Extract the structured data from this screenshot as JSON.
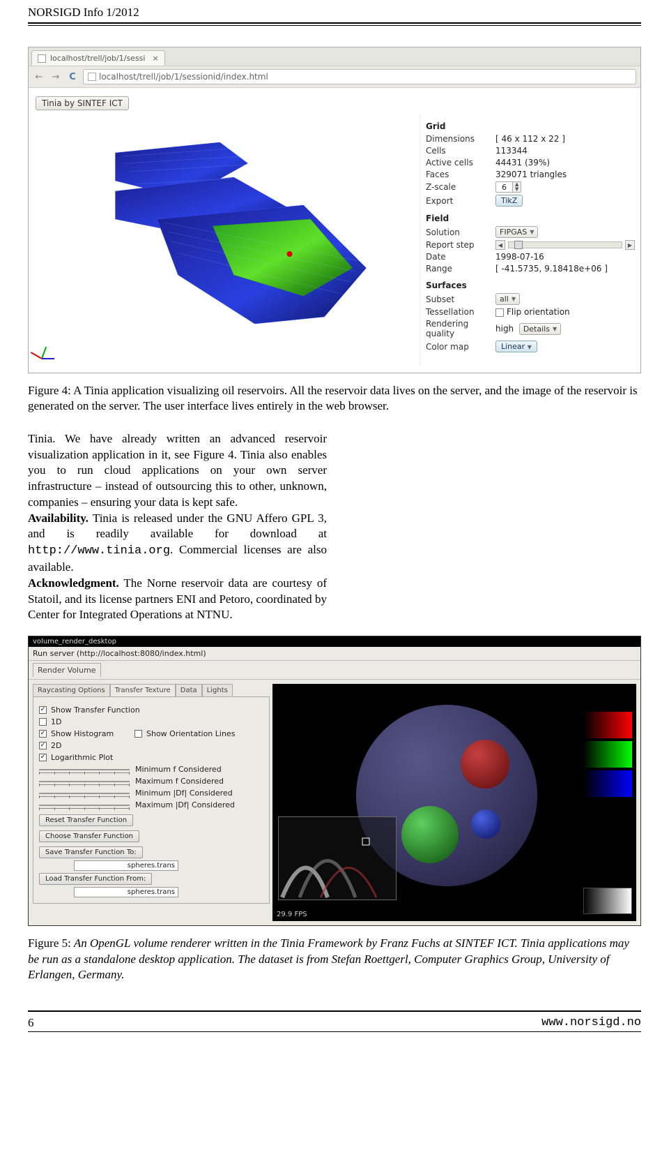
{
  "header": {
    "left": "NORSIGD Info 1/2012",
    "right": ""
  },
  "browser": {
    "tab_title": "localhost/trell/job/1/sessi",
    "url": "localhost/trell/job/1/sessionid/index.html",
    "app_button": "Tinia by SINTEF ICT"
  },
  "grid": {
    "section": "Grid",
    "dimensions_label": "Dimensions",
    "dimensions": "[ 46 x 112 x 22 ]",
    "cells_label": "Cells",
    "cells": "113344",
    "active_label": "Active cells",
    "active": "44431 (39%)",
    "faces_label": "Faces",
    "faces": "329071 triangles",
    "zscale_label": "Z-scale",
    "zscale": "6",
    "export_label": "Export",
    "export_btn": "TikZ"
  },
  "field": {
    "section": "Field",
    "solution_label": "Solution",
    "solution": "FIPGAS",
    "report_label": "Report step",
    "date_label": "Date",
    "date": "1998-07-16",
    "range_label": "Range",
    "range": "[ -41.5735, 9.18418e+06 ]"
  },
  "surfaces": {
    "section": "Surfaces",
    "subset_label": "Subset",
    "subset": "all",
    "tess_label": "Tessellation",
    "tess_chk": "Flip orientation",
    "rq_label": "Rendering quality",
    "rq_val": "high",
    "rq_btn": "Details",
    "cmap_label": "Color map",
    "cmap_btn": "Linear"
  },
  "fig4_caption_lead": "Figure 4:",
  "fig4_caption": "A Tinia application visualizing oil reservoirs. All the reservoir data lives on the server, and the image of the reservoir is generated on the server. The user interface lives entirely in the web browser.",
  "body_para": "Tinia. We have already written an advanced reservoir visualization application in it, see Figure 4. Tinia also enables you to run cloud applications on your own server infrastructure – instead of outsourcing this to other, unknown, companies – ensuring your data is kept safe.",
  "body_avail_lead": "Availability.",
  "body_avail": " Tinia is released under the GNU Affero GPL 3, and is readily available for download at ",
  "body_url": "http://www.tinia.org",
  "body_avail_tail": ". Commercial licenses are also available.",
  "body_ack_lead": "Acknowledgment.",
  "body_ack": " The Norne reservoir data are courtesy of Statoil, and its license partners ENI and Petoro, coordinated by Center for Integrated Operations at NTNU.",
  "darkapp": {
    "title": "volume_render_desktop",
    "run_server": "Run server (http://localhost:8080/index.html)",
    "tab_render": "Render Volume",
    "tabs": {
      "rc": "Raycasting Options",
      "tt": "Transfer Texture",
      "data": "Data",
      "lights": "Lights"
    },
    "chk_show_tf": "Show Transfer Function",
    "chk_1d": "1D",
    "chk_show_hist": "Show Histogram",
    "chk_orient": "Show Orientation Lines",
    "chk_2d": "2D",
    "chk_log": "Logarithmic Plot",
    "sl_min_f": "Minimum f Considered",
    "sl_max_f": "Maximum f Considered",
    "sl_min_df": "Minimum |Df| Considered",
    "sl_max_df": "Maximum |Df| Considered",
    "btn_reset": "Reset Transfer Function",
    "btn_choose": "Choose Transfer Function",
    "btn_save": "Save Transfer Function To:",
    "save_val": "spheres.trans",
    "btn_load": "Load Transfer Function From:",
    "load_val": "spheres.trans",
    "fps": "29.9 FPS"
  },
  "fig5_caption_lead": "Figure 5:",
  "fig5_caption": "An OpenGL volume renderer written in the Tinia Framework by Franz Fuchs at SINTEF ICT. Tinia applications may be run as a standalone desktop application. The dataset is from Stefan Roettgerl, Computer Graphics Group, University of Erlangen, Germany.",
  "footer": {
    "page": "6",
    "url": "www.norsigd.no"
  }
}
